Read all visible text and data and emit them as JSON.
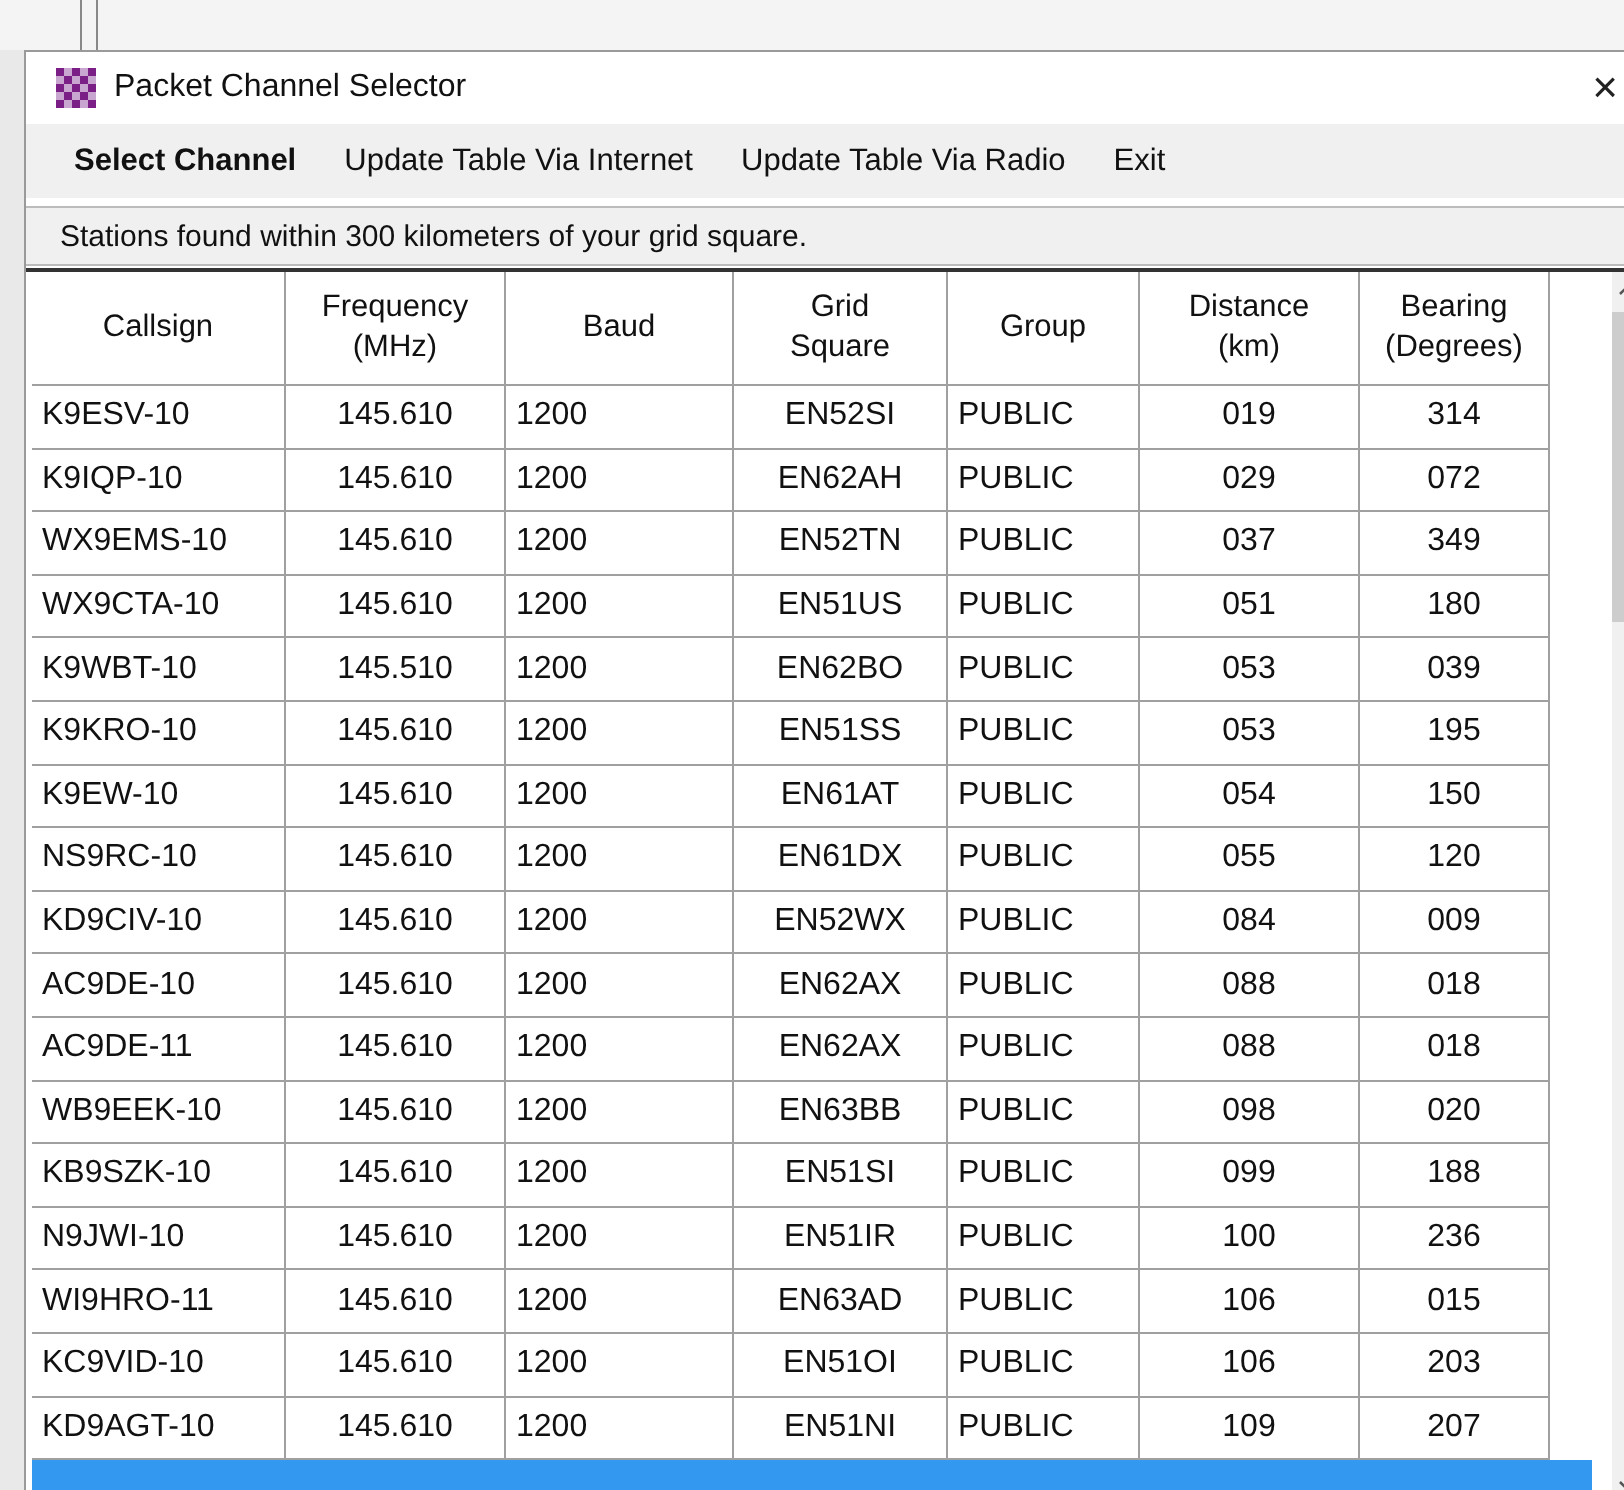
{
  "window": {
    "title": "Packet Channel Selector",
    "close": "×"
  },
  "menu": [
    {
      "label": "Select Channel",
      "selected": true
    },
    {
      "label": "Update Table Via Internet",
      "selected": false
    },
    {
      "label": "Update Table Via Radio",
      "selected": false
    },
    {
      "label": "Exit",
      "selected": false
    }
  ],
  "status": "Stations found within 300 kilometers of your grid square.",
  "table": {
    "columns": [
      "Callsign",
      "Frequency\n(MHz)",
      "Baud",
      "Grid\nSquare",
      "Group",
      "Distance\n(km)",
      "Bearing\n(Degrees)"
    ],
    "rows": [
      {
        "cells": [
          "K9ESV-10",
          "145.610",
          "1200",
          "EN52SI",
          "PUBLIC",
          "019",
          "314"
        ],
        "selected": false
      },
      {
        "cells": [
          "K9IQP-10",
          "145.610",
          "1200",
          "EN62AH",
          "PUBLIC",
          "029",
          "072"
        ],
        "selected": false
      },
      {
        "cells": [
          "WX9EMS-10",
          "145.610",
          "1200",
          "EN52TN",
          "PUBLIC",
          "037",
          "349"
        ],
        "selected": false
      },
      {
        "cells": [
          "WX9CTA-10",
          "145.610",
          "1200",
          "EN51US",
          "PUBLIC",
          "051",
          "180"
        ],
        "selected": false
      },
      {
        "cells": [
          "K9WBT-10",
          "145.510",
          "1200",
          "EN62BO",
          "PUBLIC",
          "053",
          "039"
        ],
        "selected": false
      },
      {
        "cells": [
          "K9KRO-10",
          "145.610",
          "1200",
          "EN51SS",
          "PUBLIC",
          "053",
          "195"
        ],
        "selected": false
      },
      {
        "cells": [
          "K9EW-10",
          "145.610",
          "1200",
          "EN61AT",
          "PUBLIC",
          "054",
          "150"
        ],
        "selected": false
      },
      {
        "cells": [
          "NS9RC-10",
          "145.610",
          "1200",
          "EN61DX",
          "PUBLIC",
          "055",
          "120"
        ],
        "selected": false
      },
      {
        "cells": [
          "KD9CIV-10",
          "145.610",
          "1200",
          "EN52WX",
          "PUBLIC",
          "084",
          "009"
        ],
        "selected": false
      },
      {
        "cells": [
          "AC9DE-10",
          "145.610",
          "1200",
          "EN62AX",
          "PUBLIC",
          "088",
          "018"
        ],
        "selected": false
      },
      {
        "cells": [
          "AC9DE-11",
          "145.610",
          "1200",
          "EN62AX",
          "PUBLIC",
          "088",
          "018"
        ],
        "selected": false
      },
      {
        "cells": [
          "WB9EEK-10",
          "145.610",
          "1200",
          "EN63BB",
          "PUBLIC",
          "098",
          "020"
        ],
        "selected": false
      },
      {
        "cells": [
          "KB9SZK-10",
          "145.610",
          "1200",
          "EN51SI",
          "PUBLIC",
          "099",
          "188"
        ],
        "selected": false
      },
      {
        "cells": [
          "N9JWI-10",
          "145.610",
          "1200",
          "EN51IR",
          "PUBLIC",
          "100",
          "236"
        ],
        "selected": false
      },
      {
        "cells": [
          "WI9HRO-11",
          "145.610",
          "1200",
          "EN63AD",
          "PUBLIC",
          "106",
          "015"
        ],
        "selected": false
      },
      {
        "cells": [
          "KC9VID-10",
          "145.610",
          "1200",
          "EN51OI",
          "PUBLIC",
          "106",
          "203"
        ],
        "selected": false
      },
      {
        "cells": [
          "KD9AGT-10",
          "145.610",
          "1200",
          "EN51NI",
          "PUBLIC",
          "109",
          "207"
        ],
        "selected": false
      },
      {
        "selected": true
      }
    ]
  }
}
